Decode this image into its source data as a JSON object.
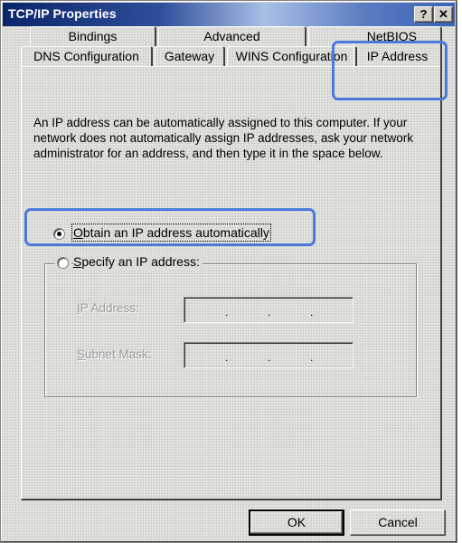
{
  "window": {
    "title": "TCP/IP Properties",
    "help_label": "?",
    "close_label": "✕"
  },
  "tabs": {
    "back_row": [
      {
        "label": "Bindings"
      },
      {
        "label": "Advanced"
      },
      {
        "label": "NetBIOS"
      }
    ],
    "front_row": [
      {
        "label": "DNS Configuration"
      },
      {
        "label": "Gateway"
      },
      {
        "label": "WINS Configuration"
      },
      {
        "label": "IP Address"
      }
    ],
    "active": "IP Address"
  },
  "ip_tab": {
    "description": "An IP address can be automatically assigned to this computer. If your network does not automatically assign IP addresses, ask your network administrator for an address, and then type it in the space below.",
    "option_auto": {
      "label_first": "O",
      "label_rest": "btain an IP address automatically",
      "selected": true
    },
    "option_specify": {
      "label_first": "S",
      "label_rest": "pecify an IP address:",
      "selected": false
    },
    "ip_address_label": {
      "first": "I",
      "rest": "P Address:"
    },
    "subnet_mask_label": {
      "first": "S",
      "rest": "ubnet Mask:"
    },
    "ip_address_value": [
      "",
      "",
      "",
      ""
    ],
    "subnet_mask_value": [
      "",
      "",
      "",
      ""
    ]
  },
  "buttons": {
    "ok": "OK",
    "cancel": "Cancel"
  },
  "colors": {
    "highlight": "#4a7bdc",
    "titlebar_start": "#0a246a",
    "face": "#dcdcd8"
  }
}
